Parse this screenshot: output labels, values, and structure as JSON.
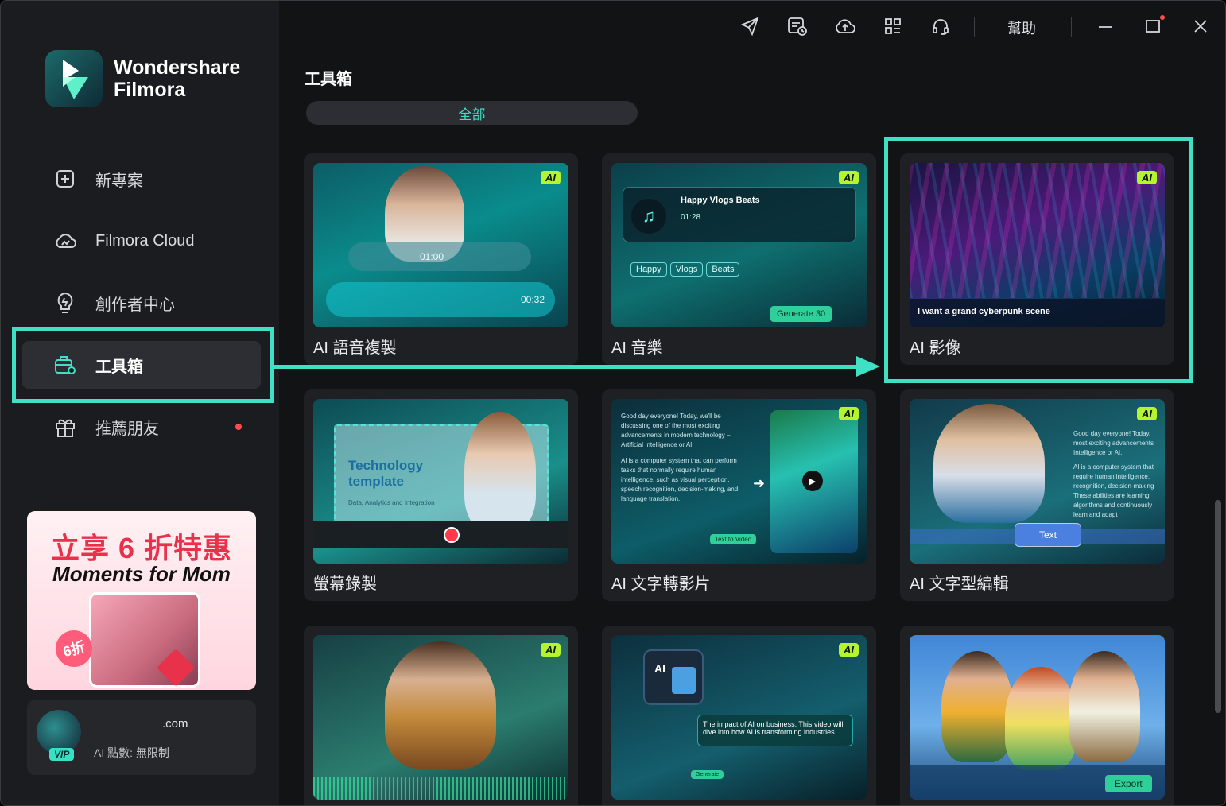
{
  "app": {
    "brand_line1": "Wondershare",
    "brand_line2": "Filmora"
  },
  "sidebar": {
    "items": [
      {
        "label": "新專案",
        "icon": "plus-square-icon"
      },
      {
        "label": "Filmora Cloud",
        "icon": "cloud-icon"
      },
      {
        "label": "創作者中心",
        "icon": "lightbulb-icon"
      },
      {
        "label": "工具箱",
        "icon": "toolbox-icon",
        "active": true
      },
      {
        "label": "推薦朋友",
        "icon": "gift-icon",
        "has_dot": true
      }
    ],
    "promo": {
      "title": "立享 6 折特惠",
      "subtitle": "Moments for Mom",
      "badge": "6折"
    },
    "account": {
      "email": ".com",
      "points": "AI 點數: 無限制",
      "badge": "VIP"
    }
  },
  "topbar": {
    "icons": [
      "send-icon",
      "calendar-clock-icon",
      "cloud-upload-icon",
      "apps-grid-icon",
      "headset-icon"
    ],
    "help_label": "幫助",
    "window_controls": [
      "minimize-icon",
      "maximize-icon",
      "close-icon"
    ]
  },
  "main": {
    "title": "工具箱",
    "filter": "全部",
    "cards": [
      {
        "label": "AI 語音複製",
        "ai": true,
        "thumb": "voice",
        "wave1_time": "01:00",
        "wave2_time": "00:32"
      },
      {
        "label": "AI 音樂",
        "ai": true,
        "thumb": "music",
        "track": "Happy Vlogs Beats",
        "time": "01:28",
        "chips": [
          "Happy",
          "Vlogs",
          "Beats"
        ],
        "generate": "Generate",
        "credits": "30"
      },
      {
        "label": "AI 影像",
        "ai": true,
        "thumb": "image",
        "prompt": "I want a grand cyberpunk scene"
      },
      {
        "label": "螢幕錄製",
        "ai": false,
        "thumb": "record",
        "heading": "Technology template",
        "sub": "Data, Analytics and Integration"
      },
      {
        "label": "AI 文字轉影片",
        "ai": true,
        "thumb": "t2v",
        "para1": "Good day everyone! Today, we'll be discussing one of the most exciting advancements in modern technology – Artificial Intelligence or AI.",
        "para2": "AI is a computer system that can perform tasks that normally require human intelligence, such as visual perception, speech recognition, decision-making, and language translation.",
        "button": "Text to Video"
      },
      {
        "label": "AI 文字型編輯",
        "ai": true,
        "thumb": "textedit",
        "para1": "Good day everyone! Today, most exciting advancements Intelligence or AI.",
        "para2": "AI is a computer system that require human intelligence, recognition, decision-making These abilities are learning algorithms and continuously learn and adapt",
        "text_chip": "Text"
      },
      {
        "label": "",
        "ai": true,
        "thumb": "podcast"
      },
      {
        "label": "",
        "ai": true,
        "thumb": "aitext",
        "caption": "The impact of AI on business: This video will dive into how AI is transforming industries.",
        "button": "Generate"
      },
      {
        "label": "",
        "ai": false,
        "thumb": "dance",
        "button": "Export"
      }
    ],
    "ai_badge": "AI"
  },
  "colors": {
    "accent": "#3fe0c4",
    "ai_badge": "#b4f52e",
    "bg": "#121315",
    "sidebar": "#1b1c1f"
  }
}
